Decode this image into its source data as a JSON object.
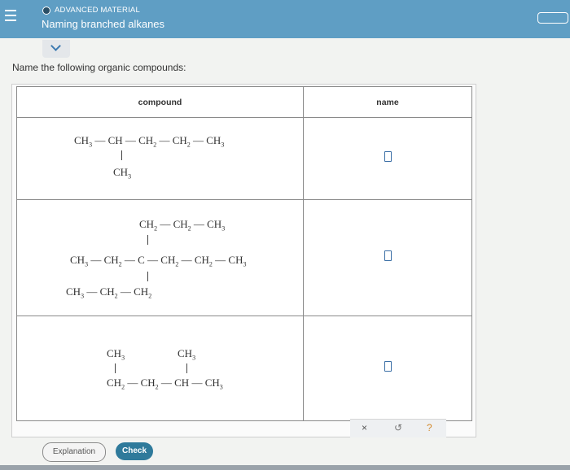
{
  "header": {
    "category": "ADVANCED MATERIAL",
    "title": "Naming branched alkanes"
  },
  "prompt": "Name the following organic compounds:",
  "table": {
    "col_compound": "compound",
    "col_name": "name"
  },
  "compounds": [
    {
      "main": [
        "CH3",
        "CH",
        "CH2",
        "CH2",
        "CH3"
      ],
      "branch_below": "CH3"
    },
    {
      "above": [
        "CH2",
        "CH2",
        "CH3"
      ],
      "main": [
        "CH3",
        "CH2",
        "C",
        "CH2",
        "CH2",
        "CH3"
      ],
      "below": [
        "CH3",
        "CH2",
        "CH2"
      ]
    },
    {
      "top_left": "CH3",
      "top_right": "CH3",
      "main": [
        "CH2",
        "CH2",
        "CH",
        "CH3"
      ]
    }
  ],
  "tools": {
    "clear": "×",
    "undo": "↺",
    "help": "?"
  },
  "buttons": {
    "explanation": "Explanation",
    "check": "Check"
  },
  "colors": {
    "header_bg": "#5f9ec4",
    "check_bg": "#2f7a9b",
    "answer_box": "#3a6ea5"
  }
}
